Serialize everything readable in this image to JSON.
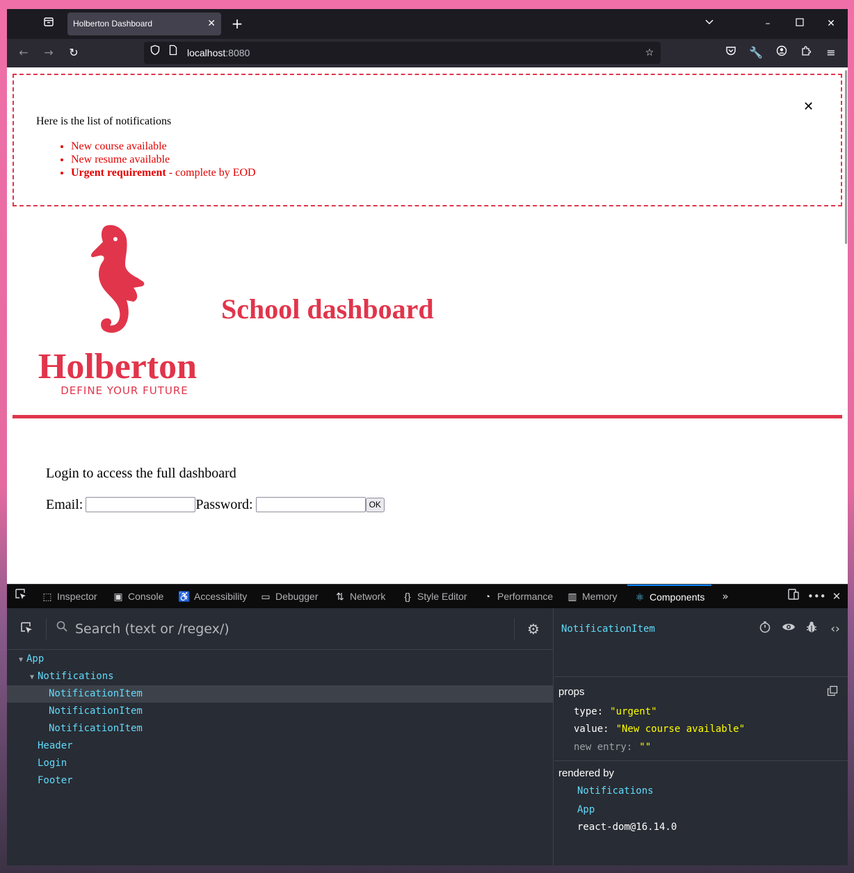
{
  "browser": {
    "tab_title": "Holberton Dashboard",
    "url_host": "localhost",
    "url_port": ":8080"
  },
  "notifications": {
    "title": "Here is the list of notifications",
    "items": [
      {
        "text": "New course available"
      },
      {
        "text": "New resume available"
      },
      {
        "strong": "Urgent requirement",
        "rest": " - complete by EOD"
      }
    ],
    "close_glyph": "✕"
  },
  "logo": {
    "wordmark": "Holberton",
    "tagline": "DEFINE YOUR FUTURE"
  },
  "header": {
    "title": "School dashboard"
  },
  "login": {
    "prompt": "Login to access the full dashboard",
    "email_label": "Email:",
    "password_label": "Password:",
    "ok_label": "OK"
  },
  "devtools": {
    "tabs": [
      {
        "label": "Inspector"
      },
      {
        "label": "Console"
      },
      {
        "label": "Accessibility"
      },
      {
        "label": "Debugger"
      },
      {
        "label": "Network"
      },
      {
        "label": "Style Editor"
      },
      {
        "label": "Performance"
      },
      {
        "label": "Memory"
      },
      {
        "label": "Components"
      }
    ],
    "active_tab": "Components"
  },
  "components": {
    "search_placeholder": "Search (text or /regex/)",
    "tree": [
      {
        "name": "App"
      },
      {
        "name": "Notifications"
      },
      {
        "name": "NotificationItem"
      },
      {
        "name": "NotificationItem"
      },
      {
        "name": "NotificationItem"
      },
      {
        "name": "Header"
      },
      {
        "name": "Login"
      },
      {
        "name": "Footer"
      }
    ],
    "selected": {
      "name": "NotificationItem",
      "props_label": "props",
      "props": [
        {
          "key": "type:",
          "value": "\"urgent\""
        },
        {
          "key": "value:",
          "value": "\"New course available\""
        },
        {
          "key": "new entry:",
          "value": "\"\""
        }
      ],
      "rendered_by_label": "rendered by",
      "rendered_by": [
        "Notifications",
        "App",
        "react-dom@16.14.0"
      ]
    }
  },
  "colors": {
    "brand": "#e1354b",
    "notif_text": "#e40000",
    "component_name": "#61dafb",
    "prop_value": "#ffff00",
    "devtools_bg": "#282c34"
  }
}
